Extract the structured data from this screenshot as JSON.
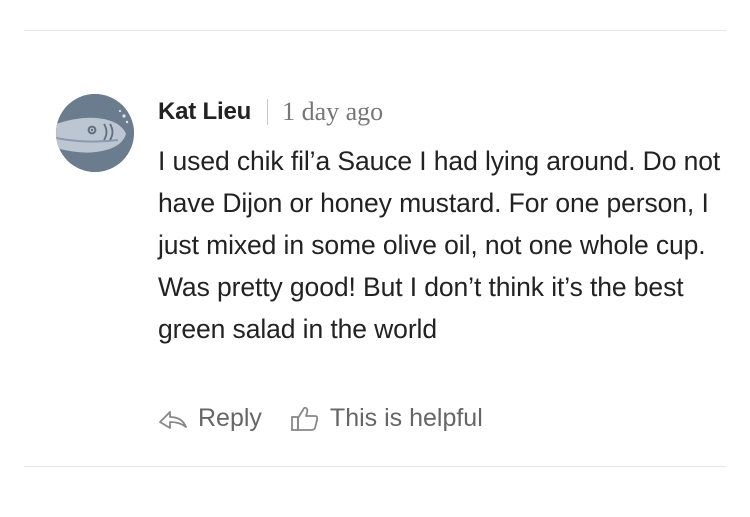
{
  "comment": {
    "author": "Kat Lieu",
    "time": "1 day ago",
    "avatar_icon": "fish-icon",
    "text": "I used chik fil’a Sauce I had lying around. Do not have Dijon or honey mustard. For one person, I just mixed in some olive oil, not one whole cup. Was pretty good! But I don’t think it’s the best green salad in the world"
  },
  "actions": {
    "reply_label": "Reply",
    "reply_icon": "reply-arrow-icon",
    "helpful_label": "This is helpful",
    "helpful_icon": "thumbs-up-icon"
  },
  "colors": {
    "avatar_bg": "#6c7c8f",
    "text": "#222222",
    "muted": "#777777",
    "divider": "#e6e6e6"
  }
}
